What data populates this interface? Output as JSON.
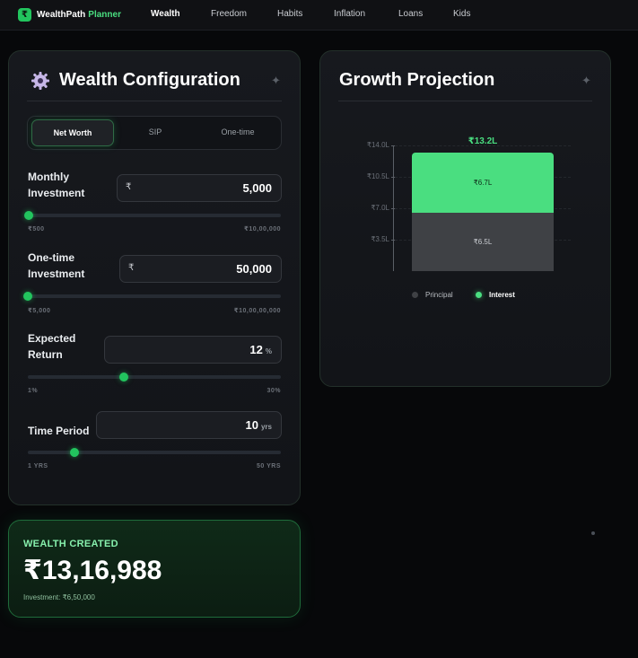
{
  "brand": {
    "name": "WealthPath",
    "accent": "Planner",
    "logo_glyph": "₹"
  },
  "nav": {
    "links": [
      "Wealth",
      "Freedom",
      "Habits",
      "Inflation",
      "Loans",
      "Kids"
    ],
    "active": "Wealth"
  },
  "config": {
    "title": "Wealth Configuration",
    "icon": "gear-icon",
    "tabs": [
      "Net Worth",
      "SIP",
      "One-time"
    ],
    "active_tab": "Net Worth",
    "monthly": {
      "label_line1": "Monthly",
      "label_line2": "Investment",
      "prefix": "₹",
      "value": "5,000",
      "min_label": "₹500",
      "max_label": "₹10,00,000",
      "position": 0.0045
    },
    "onetime": {
      "label_line1": "One-time",
      "label_line2": "Investment",
      "prefix": "₹",
      "value": "50,000",
      "min_label": "₹5,000",
      "max_label": "₹10,00,00,000",
      "position": 0.0005
    },
    "return": {
      "label_line1": "Expected",
      "label_line2": "Return",
      "value": "12",
      "suffix": "%",
      "min_label": "1%",
      "max_label": "30%",
      "position": 0.379
    },
    "period": {
      "label": "Time Period",
      "value": "10",
      "suffix": "yrs",
      "min_label": "1 YRS",
      "max_label": "50 YRS",
      "position": 0.184
    }
  },
  "wealth": {
    "heading": "WEALTH CREATED",
    "amount": "₹13,16,988",
    "investment_label": "Investment: ₹6,50,000"
  },
  "growth": {
    "title": "Growth Projection"
  },
  "chart_data": {
    "type": "bar",
    "stacked": true,
    "categories": [
      ""
    ],
    "series": [
      {
        "name": "Principal",
        "values": [
          6.5
        ],
        "label": "₹6.5L",
        "color": "#3f4145"
      },
      {
        "name": "Interest",
        "values": [
          6.7
        ],
        "label": "₹6.7L",
        "color": "#4ade80"
      }
    ],
    "total_label": "₹13.2L",
    "yticks": [
      3.5,
      7.0,
      10.5,
      14.0
    ],
    "ytick_labels": [
      "₹3.5L",
      "₹7.0L",
      "₹10.5L",
      "₹14.0L"
    ],
    "ylim": [
      0,
      14.0
    ],
    "legend_position": "bottom"
  },
  "colors": {
    "accent": "#22c55e",
    "accent_light": "#4ade80",
    "bg": "#07080a"
  }
}
